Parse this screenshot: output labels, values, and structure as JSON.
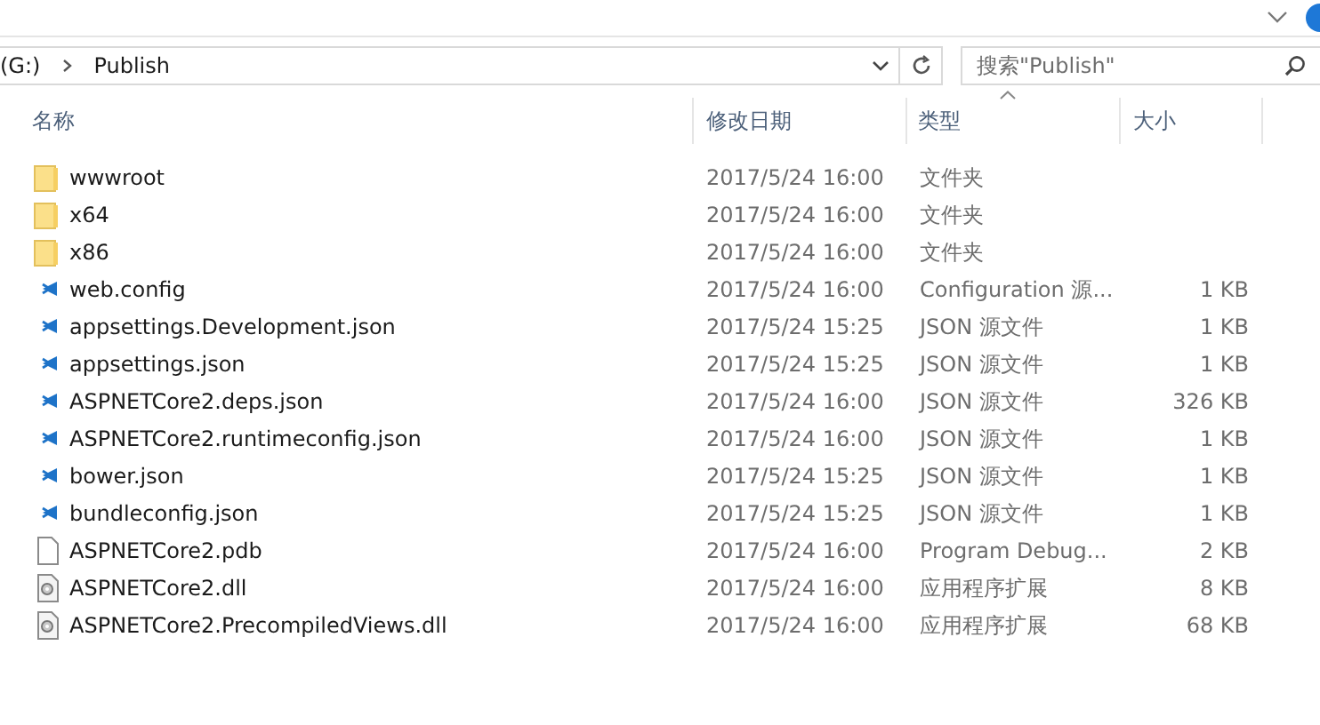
{
  "address_bar": {
    "path": [
      "(G:)",
      "Publish"
    ]
  },
  "search": {
    "placeholder": "搜索\"Publish\""
  },
  "columns": [
    {
      "label": "名称",
      "sorted": false
    },
    {
      "label": "修改日期",
      "sorted": false
    },
    {
      "label": "类型",
      "sorted": true
    },
    {
      "label": "大小",
      "sorted": false
    }
  ],
  "files": [
    {
      "kind": "folder",
      "name": "wwwroot",
      "modified": "2017/5/24 16:00",
      "type": "文件夹"
    },
    {
      "kind": "folder",
      "name": "x64",
      "modified": "2017/5/24 16:00",
      "type": "文件夹"
    },
    {
      "kind": "folder",
      "name": "x86",
      "modified": "2017/5/24 16:00",
      "type": "文件夹"
    },
    {
      "kind": "code",
      "name": "web.config",
      "modified": "2017/5/24 16:00",
      "type": "Configuration 源...",
      "size": "1 KB"
    },
    {
      "kind": "code",
      "name": "appsettings.Development.json",
      "modified": "2017/5/24 15:25",
      "type": "JSON 源文件",
      "size": "1 KB"
    },
    {
      "kind": "code",
      "name": "appsettings.json",
      "modified": "2017/5/24 15:25",
      "type": "JSON 源文件",
      "size": "1 KB"
    },
    {
      "kind": "code",
      "name": "ASPNETCore2.deps.json",
      "modified": "2017/5/24 16:00",
      "type": "JSON 源文件",
      "size": "326 KB"
    },
    {
      "kind": "code",
      "name": "ASPNETCore2.runtimeconfig.json",
      "modified": "2017/5/24 16:00",
      "type": "JSON 源文件",
      "size": "1 KB"
    },
    {
      "kind": "code",
      "name": "bower.json",
      "modified": "2017/5/24 15:25",
      "type": "JSON 源文件",
      "size": "1 KB"
    },
    {
      "kind": "code",
      "name": "bundleconfig.json",
      "modified": "2017/5/24 15:25",
      "type": "JSON 源文件",
      "size": "1 KB"
    },
    {
      "kind": "blank",
      "name": "ASPNETCore2.pdb",
      "modified": "2017/5/24 16:00",
      "type": "Program Debug...",
      "size": "2 KB"
    },
    {
      "kind": "dll",
      "name": "ASPNETCore2.dll",
      "modified": "2017/5/24 16:00",
      "type": "应用程序扩展",
      "size": "8 KB"
    },
    {
      "kind": "dll",
      "name": "ASPNETCore2.PrecompiledViews.dll",
      "modified": "2017/5/24 16:00",
      "type": "应用程序扩展",
      "size": "68 KB"
    }
  ]
}
